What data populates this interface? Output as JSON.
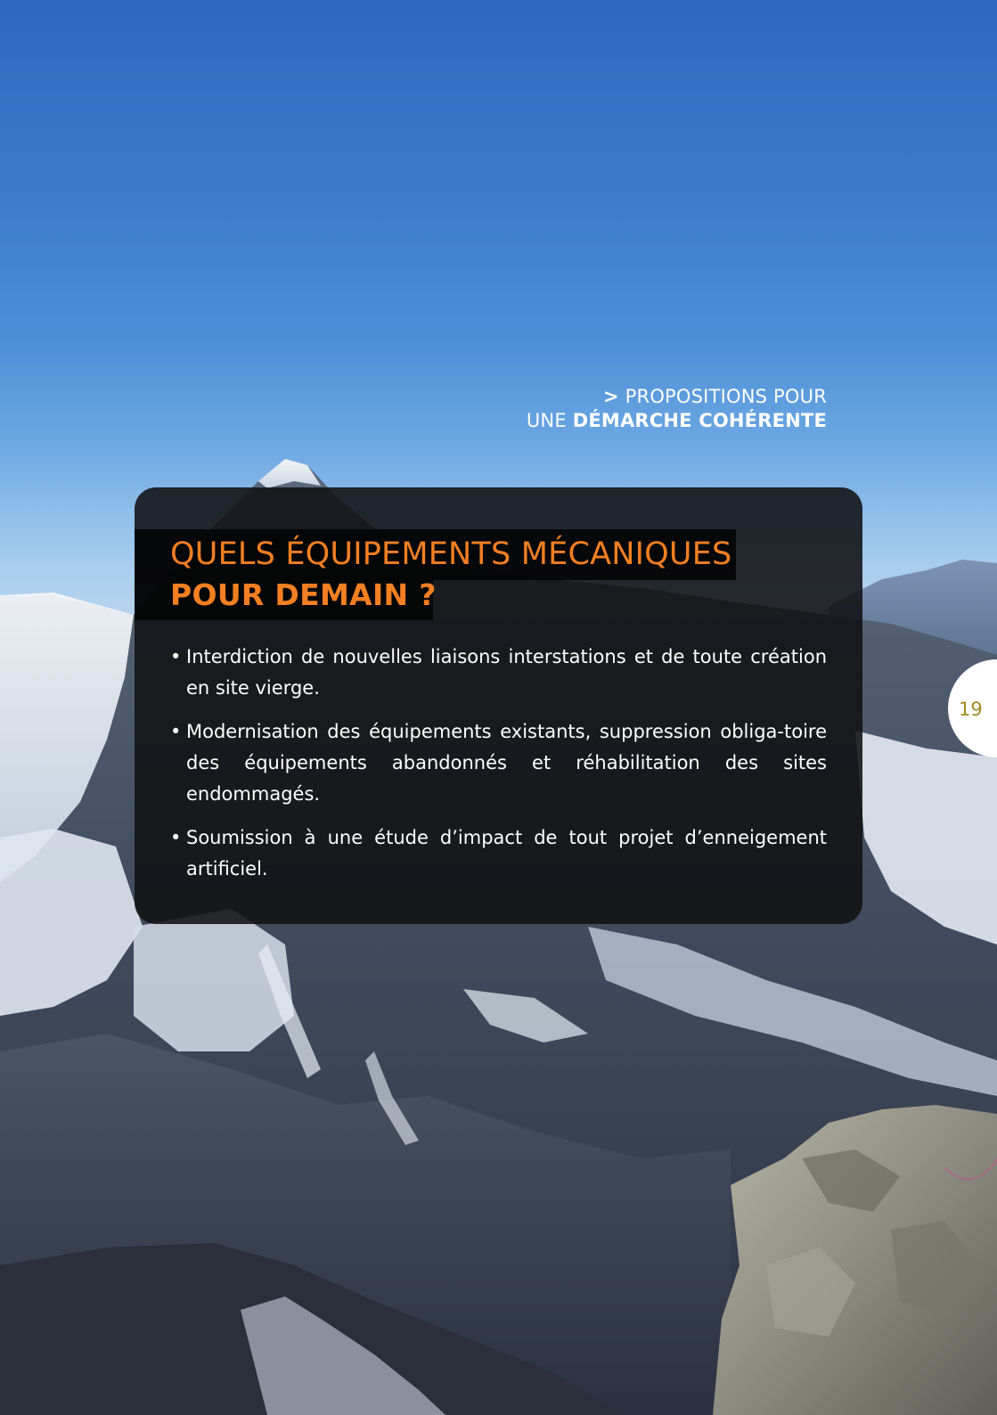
{
  "header": {
    "gt": ">",
    "line1": "PROPOSITIONS POUR",
    "line2_light": "UNE",
    "line2_bold": "DÉMARCHE COHÉRENTE"
  },
  "box": {
    "title_line1": "QUELS ÉQUIPEMENTS MÉCANIQUES",
    "title_line2": "POUR DEMAIN ?",
    "bullets": [
      "Interdiction de nouvelles liaisons interstations et de toute création en site vierge.",
      "Modernisation des équipements existants, suppression obliga-toire des équipements abandonnés et réhabilitation des sites endommagés.",
      "Soumission à une étude d’impact de tout projet d’enneigement artificiel."
    ]
  },
  "page_number": "19",
  "colors": {
    "accent": "#f27f22",
    "page_number": "#a08a1e",
    "panel": "#111113"
  }
}
